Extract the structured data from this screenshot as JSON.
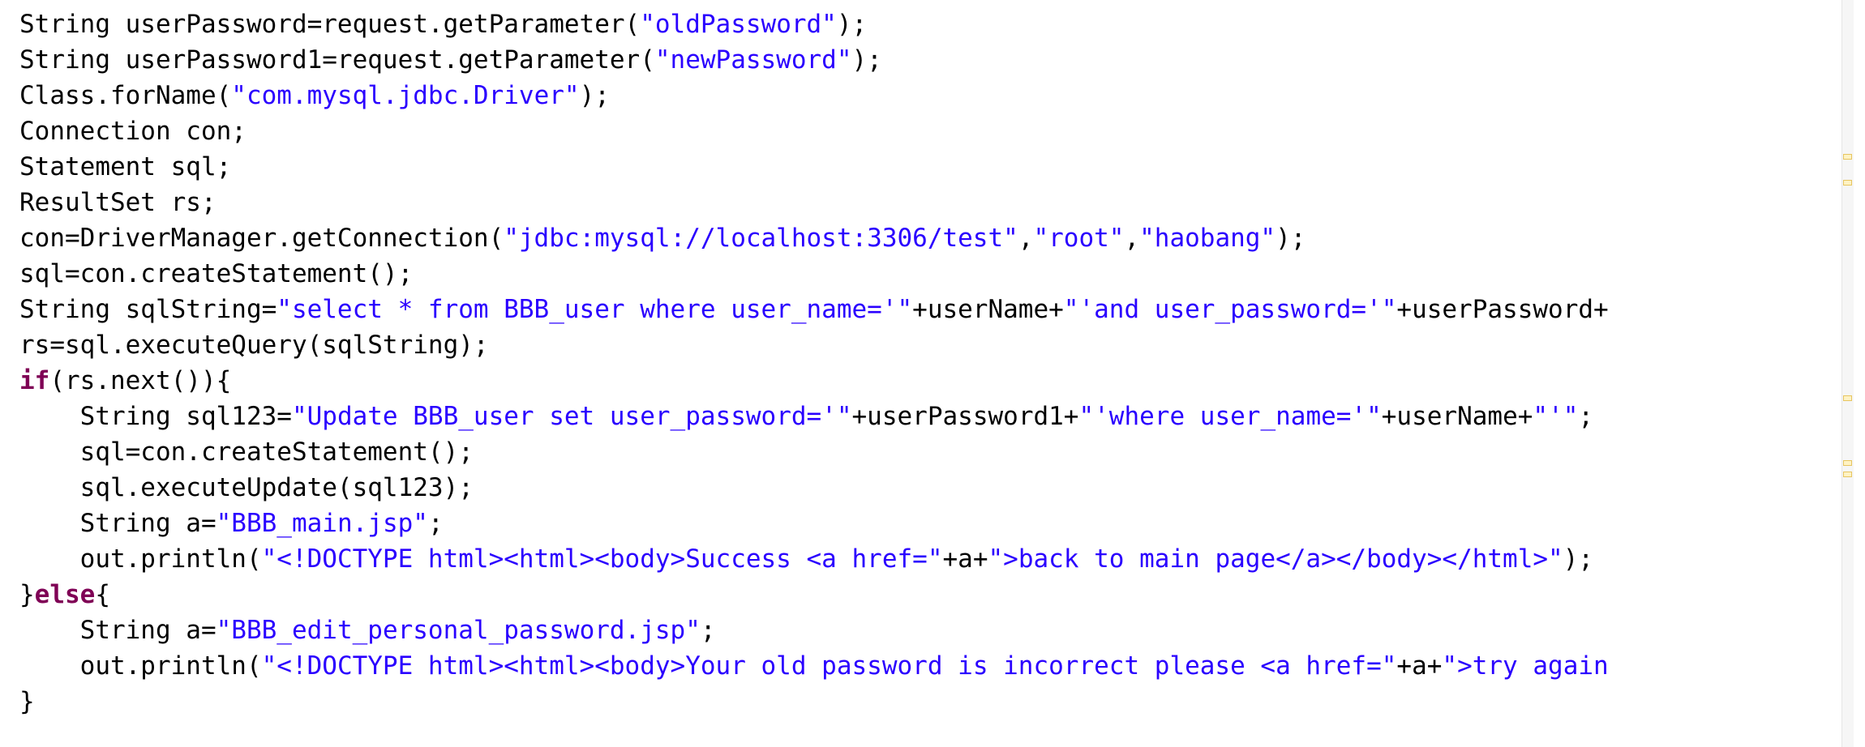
{
  "colors": {
    "string": "#2a00ff",
    "keyword": "#7f0055",
    "plain": "#000000",
    "background": "#ffffff",
    "overview_marker": "#e7c560"
  },
  "code": {
    "lines": [
      {
        "indent": "",
        "tokens": [
          {
            "t": "plain",
            "v": "String userPassword=request.getParameter("
          },
          {
            "t": "str",
            "v": "\"oldPassword\""
          },
          {
            "t": "plain",
            "v": ");"
          }
        ]
      },
      {
        "indent": "",
        "tokens": [
          {
            "t": "plain",
            "v": "String userPassword1=request.getParameter("
          },
          {
            "t": "str",
            "v": "\"newPassword\""
          },
          {
            "t": "plain",
            "v": ");"
          }
        ]
      },
      {
        "indent": "",
        "tokens": [
          {
            "t": "plain",
            "v": "Class.forName("
          },
          {
            "t": "str",
            "v": "\"com.mysql.jdbc.Driver\""
          },
          {
            "t": "plain",
            "v": ");"
          }
        ]
      },
      {
        "indent": "",
        "tokens": [
          {
            "t": "plain",
            "v": "Connection con;"
          }
        ]
      },
      {
        "indent": "",
        "tokens": [
          {
            "t": "plain",
            "v": "Statement sql;"
          }
        ]
      },
      {
        "indent": "",
        "tokens": [
          {
            "t": "plain",
            "v": "ResultSet rs;"
          }
        ]
      },
      {
        "indent": "",
        "tokens": [
          {
            "t": "plain",
            "v": "con=DriverManager.getConnection("
          },
          {
            "t": "str",
            "v": "\"jdbc:mysql://localhost:3306/test\""
          },
          {
            "t": "plain",
            "v": ","
          },
          {
            "t": "str",
            "v": "\"root\""
          },
          {
            "t": "plain",
            "v": ","
          },
          {
            "t": "str",
            "v": "\"haobang\""
          },
          {
            "t": "plain",
            "v": ");"
          }
        ]
      },
      {
        "indent": "",
        "tokens": [
          {
            "t": "plain",
            "v": "sql=con.createStatement();"
          }
        ]
      },
      {
        "indent": "",
        "tokens": [
          {
            "t": "plain",
            "v": "String sqlString="
          },
          {
            "t": "str",
            "v": "\"select * from BBB_user where user_name='\""
          },
          {
            "t": "plain",
            "v": "+userName+"
          },
          {
            "t": "str",
            "v": "\"'and user_password='\""
          },
          {
            "t": "plain",
            "v": "+userPassword+"
          }
        ]
      },
      {
        "indent": "",
        "tokens": [
          {
            "t": "plain",
            "v": "rs=sql.executeQuery(sqlString);"
          }
        ]
      },
      {
        "indent": "",
        "tokens": [
          {
            "t": "kw",
            "v": "if"
          },
          {
            "t": "plain",
            "v": "(rs.next()){"
          }
        ]
      },
      {
        "indent": "    ",
        "tokens": [
          {
            "t": "plain",
            "v": "String sql123="
          },
          {
            "t": "str",
            "v": "\"Update BBB_user set user_password='\""
          },
          {
            "t": "plain",
            "v": "+userPassword1+"
          },
          {
            "t": "str",
            "v": "\"'where user_name='\""
          },
          {
            "t": "plain",
            "v": "+userName+"
          },
          {
            "t": "str",
            "v": "\"'\""
          },
          {
            "t": "plain",
            "v": ";"
          }
        ]
      },
      {
        "indent": "    ",
        "tokens": [
          {
            "t": "plain",
            "v": "sql=con.createStatement();"
          }
        ]
      },
      {
        "indent": "    ",
        "tokens": [
          {
            "t": "plain",
            "v": "sql.executeUpdate(sql123);"
          }
        ]
      },
      {
        "indent": "    ",
        "tokens": [
          {
            "t": "plain",
            "v": "String a="
          },
          {
            "t": "str",
            "v": "\"BBB_main.jsp\""
          },
          {
            "t": "plain",
            "v": ";"
          }
        ]
      },
      {
        "indent": "    ",
        "tokens": [
          {
            "t": "plain",
            "v": "out.println("
          },
          {
            "t": "str",
            "v": "\"<!DOCTYPE html><html><body>Success <a href=\""
          },
          {
            "t": "plain",
            "v": "+a+"
          },
          {
            "t": "str",
            "v": "\">back to main page</a></body></html>\""
          },
          {
            "t": "plain",
            "v": ");"
          }
        ]
      },
      {
        "indent": "",
        "tokens": [
          {
            "t": "plain",
            "v": "}"
          },
          {
            "t": "kw",
            "v": "else"
          },
          {
            "t": "plain",
            "v": "{"
          }
        ]
      },
      {
        "indent": "    ",
        "tokens": [
          {
            "t": "plain",
            "v": "String a="
          },
          {
            "t": "str",
            "v": "\"BBB_edit_personal_password.jsp\""
          },
          {
            "t": "plain",
            "v": ";"
          }
        ]
      },
      {
        "indent": "    ",
        "tokens": [
          {
            "t": "plain",
            "v": "out.println("
          },
          {
            "t": "str",
            "v": "\"<!DOCTYPE html><html><body>Your old password is incorrect please <a href=\""
          },
          {
            "t": "plain",
            "v": "+a+"
          },
          {
            "t": "str",
            "v": "\">try again"
          }
        ]
      },
      {
        "indent": "",
        "tokens": [
          {
            "t": "plain",
            "v": "}"
          }
        ]
      }
    ]
  },
  "overview_ruler": {
    "markers": [
      "warning-marker",
      "warning-marker",
      "warning-marker",
      "warning-marker",
      "warning-marker"
    ]
  }
}
